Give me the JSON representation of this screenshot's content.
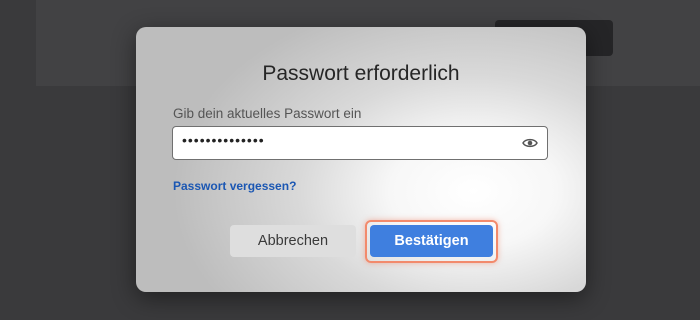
{
  "dialog": {
    "title": "Passwort erforderlich",
    "field_label": "Gib dein aktuelles Passwort ein",
    "password_value": "••••••••••••••",
    "show_password_icon": "eye-icon",
    "forgot_link": "Passwort vergessen?",
    "cancel_label": "Abbrechen",
    "confirm_label": "Bestätigen"
  },
  "colors": {
    "accent": "#3f7fdf",
    "highlight": "#f28a6c",
    "link": "#1b57b3"
  }
}
